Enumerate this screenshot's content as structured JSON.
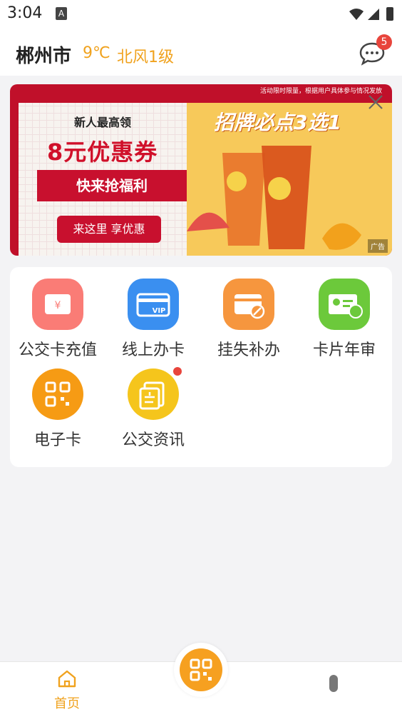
{
  "status_bar": {
    "time": "3:04",
    "notif_icon": "A"
  },
  "header": {
    "city": "郴州市",
    "temperature": "9℃",
    "wind": "北风1级",
    "message_badge": "5"
  },
  "banner": {
    "notice": "活动限时限量，根据用户具体参与情况发放",
    "paper_line1": "新人最高领",
    "paper_line2": "8元优惠券",
    "ribbon": "快来抢福利",
    "button": "来这里 享优惠",
    "promo_title": "招牌必点3选1",
    "ad_label": "广告"
  },
  "services": [
    {
      "label": "公交卡充值",
      "icon": "card-recharge-icon",
      "color": "#fa7c76"
    },
    {
      "label": "线上办卡",
      "icon": "vip-card-icon",
      "color": "#3a8ff0"
    },
    {
      "label": "挂失补办",
      "icon": "card-loss-icon",
      "color": "#f6963e"
    },
    {
      "label": "卡片年审",
      "icon": "card-review-icon",
      "color": "#6cc93b"
    },
    {
      "label": "电子卡",
      "icon": "qr-card-icon",
      "color": "#f69b14"
    },
    {
      "label": "公交资讯",
      "icon": "news-icon",
      "color": "#f5c51c"
    }
  ],
  "tabbar": {
    "home_label": "首页"
  }
}
